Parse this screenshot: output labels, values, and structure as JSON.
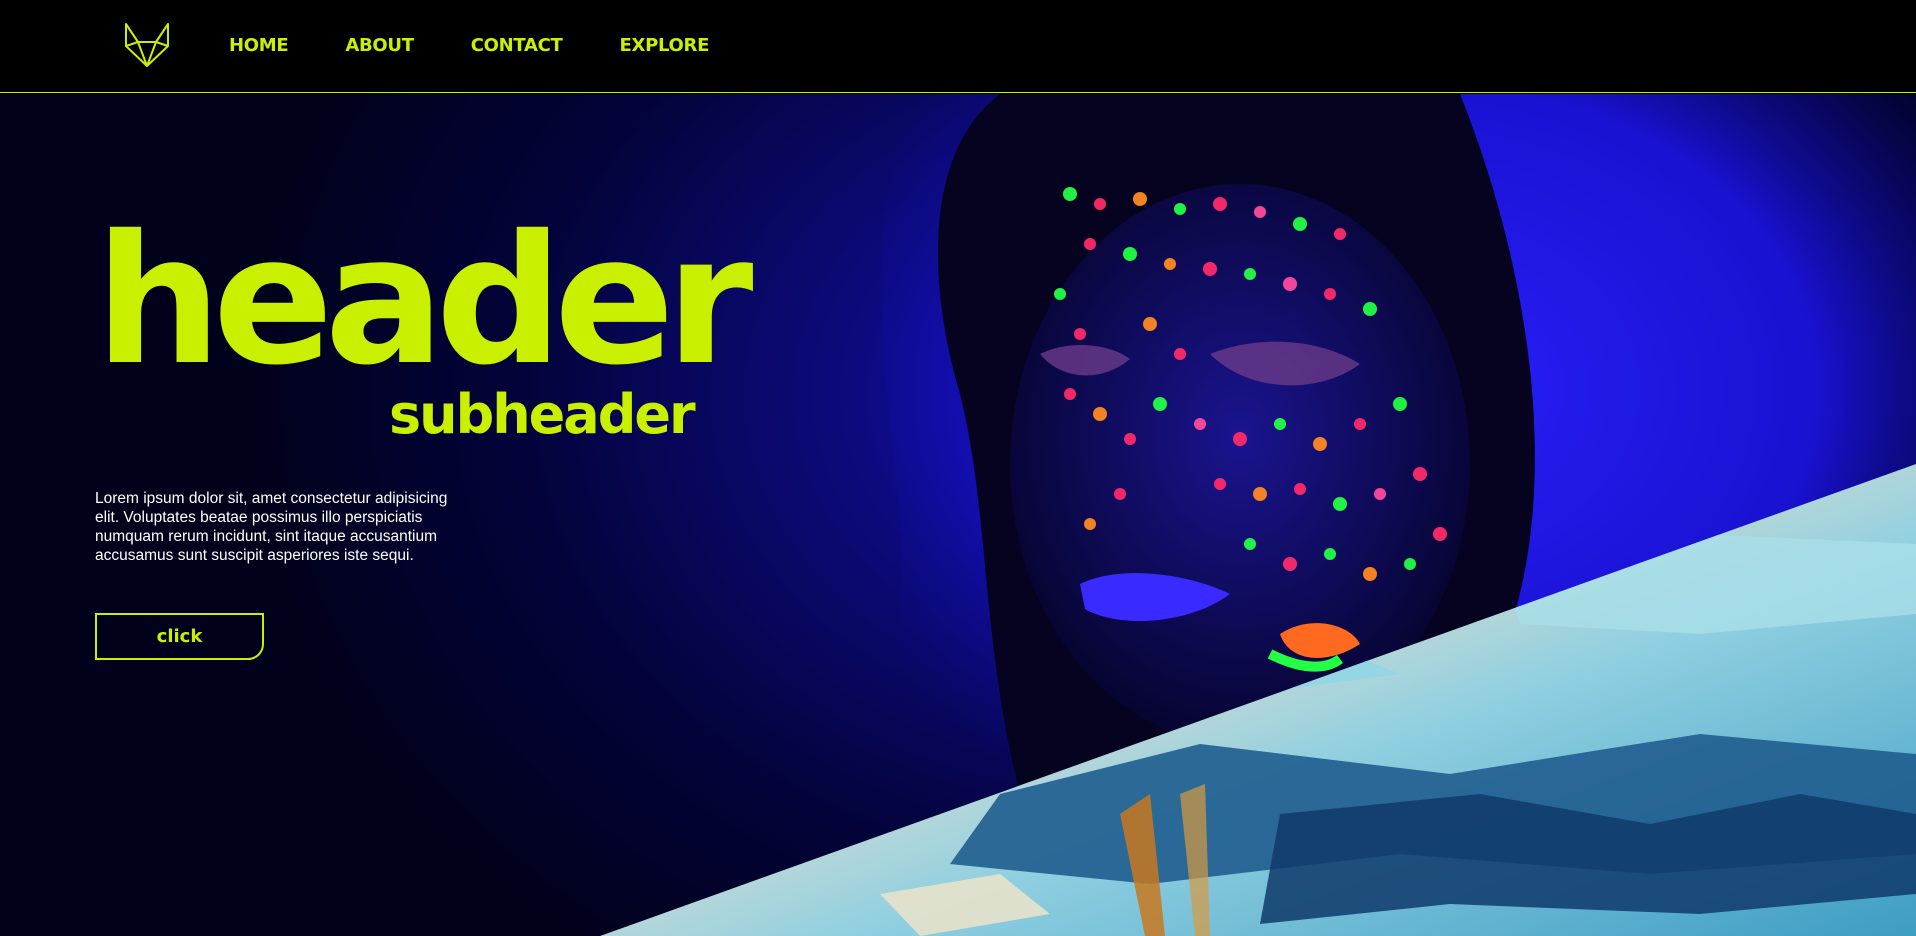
{
  "nav": {
    "logo_icon": "fox-logo-icon",
    "links": [
      {
        "label": "HOME"
      },
      {
        "label": "ABOUT"
      },
      {
        "label": "CONTACT"
      },
      {
        "label": "EXPLORE"
      }
    ]
  },
  "hero": {
    "title": "header",
    "subtitle": "subheader",
    "body": "Lorem ipsum dolor sit, amet consectetur adipisicing elit. Voluptates beatae possimus illo perspiciatis numquam rerum incidunt, sint itaque accusantium accusamus sunt suscipit asperiores iste sequi.",
    "button_label": "click"
  },
  "colors": {
    "accent": "#c8f000",
    "background": "#000000",
    "hero_blue": "#1a10c8",
    "text": "#ffffff"
  }
}
